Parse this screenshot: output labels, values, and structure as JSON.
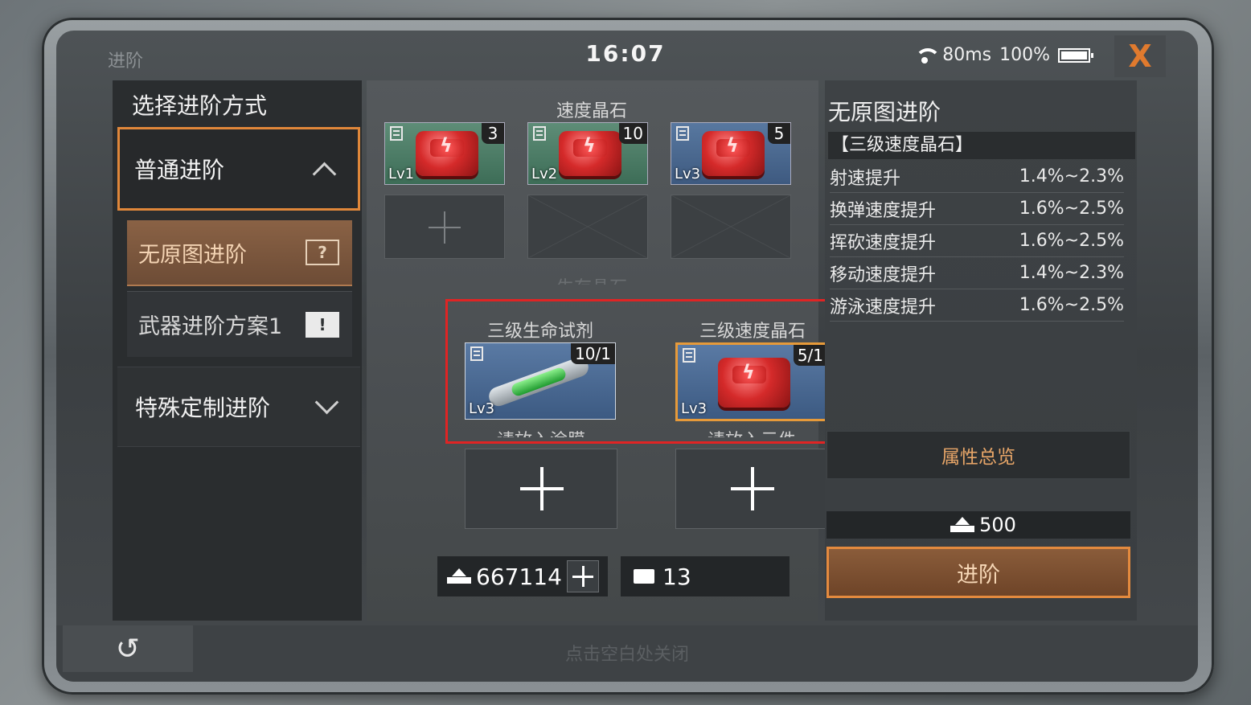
{
  "status": {
    "title": "进阶",
    "time": "16:07",
    "ping": "80ms",
    "battery": "100%",
    "close_label": "X"
  },
  "left": {
    "heading": "选择进阶方式",
    "normal_label": "普通进阶",
    "sub_items": [
      {
        "label": "无原图进阶",
        "icon": "document-question-icon"
      },
      {
        "label": "武器进阶方案1",
        "icon": "document-warning-icon"
      }
    ],
    "special_label": "特殊定制进阶"
  },
  "center": {
    "speed_title": "速度晶石",
    "speed_crystals": [
      {
        "level": "Lv1",
        "count": "3"
      },
      {
        "level": "Lv2",
        "count": "10"
      },
      {
        "level": "Lv3",
        "count": "5"
      }
    ],
    "hidden_title": "生存晶石",
    "materials": [
      {
        "title": "三级生命试剂",
        "level": "Lv3",
        "count": "10/1"
      },
      {
        "title": "三级速度晶石",
        "level": "Lv3",
        "count": "5/1"
      }
    ],
    "slot_hints": [
      "请放入涂膜",
      "请放入元件"
    ],
    "currency_amount": "667114",
    "ticket_amount": "13"
  },
  "right": {
    "title": "无原图进阶",
    "subtitle": "【三级速度晶石】",
    "stats": [
      {
        "name": "射速提升",
        "value": "1.4%~2.3%"
      },
      {
        "name": "换弹速度提升",
        "value": "1.6%~2.5%"
      },
      {
        "name": "挥砍速度提升",
        "value": "1.6%~2.5%"
      },
      {
        "name": "移动速度提升",
        "value": "1.4%~2.3%"
      },
      {
        "name": "游泳速度提升",
        "value": "1.6%~2.5%"
      }
    ],
    "overview_label": "属性总览",
    "cost": "500",
    "advance_label": "进阶"
  },
  "bottom": {
    "back_icon": "↺",
    "close_hint": "点击空白处关闭"
  },
  "colors": {
    "accent_orange": "#e48a3e",
    "highlight_red": "#e02424"
  }
}
